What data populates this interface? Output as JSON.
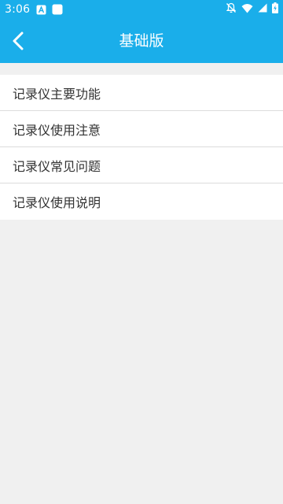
{
  "status_bar": {
    "time": "3:06",
    "icons": [
      "android-debug-icon",
      "app-notification-icon",
      "notifications-off-icon",
      "wifi-icon",
      "cell-signal-icon",
      "battery-charging-icon"
    ]
  },
  "app_bar": {
    "title": "基础版",
    "back_icon": "chevron-left-icon"
  },
  "menu": {
    "items": [
      {
        "label": "记录仪主要功能"
      },
      {
        "label": "记录仪使用注意"
      },
      {
        "label": "记录仪常见问题"
      },
      {
        "label": "记录仪使用说明"
      }
    ]
  },
  "colors": {
    "primary": "#1aaeea",
    "background": "#f0f0f0",
    "list_background": "#ffffff",
    "divider": "#dcdcdc",
    "text": "#333333"
  }
}
